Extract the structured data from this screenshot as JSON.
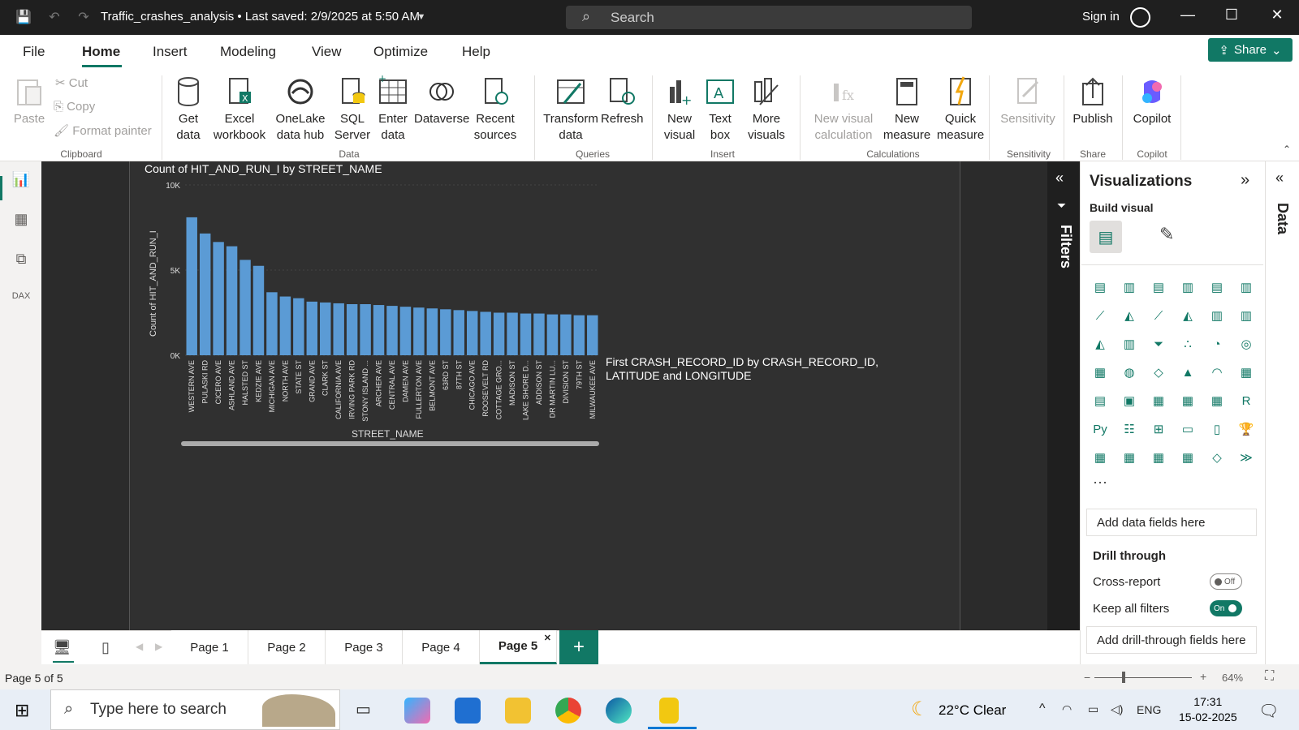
{
  "titlebar": {
    "file_title": "Traffic_crashes_analysis • Last saved: 2/9/2025 at 5:50 AM",
    "search_placeholder": "Search",
    "signin": "Sign in"
  },
  "menu": {
    "items": [
      "File",
      "Home",
      "Insert",
      "Modeling",
      "View",
      "Optimize",
      "Help"
    ],
    "share": "Share"
  },
  "ribbon": {
    "clipboard": {
      "paste": "Paste",
      "cut": "Cut",
      "copy": "Copy",
      "format_painter": "Format painter",
      "group": "Clipboard"
    },
    "data": {
      "get_data": "Get data",
      "excel": "Excel workbook",
      "onelake": "OneLake data hub",
      "sql": "SQL Server",
      "enter_data": "Enter data",
      "dataverse": "Dataverse",
      "recent": "Recent sources",
      "group": "Data"
    },
    "queries": {
      "transform": "Transform data",
      "refresh": "Refresh",
      "group": "Queries"
    },
    "insert": {
      "new_visual": "New visual",
      "text_box": "Text box",
      "more_visuals": "More visuals",
      "group": "Insert"
    },
    "calculations": {
      "new_visual_calc": "New visual calculation",
      "new_measure": "New measure",
      "quick_measure": "Quick measure",
      "group": "Calculations"
    },
    "sensitivity": {
      "label": "Sensitivity",
      "group": "Sensitivity"
    },
    "share": {
      "publish": "Publish",
      "group": "Share"
    },
    "copilot": {
      "label": "Copilot",
      "group": "Copilot"
    }
  },
  "chart_data": {
    "type": "bar",
    "title": "Count of HIT_AND_RUN_I by STREET_NAME",
    "xlabel": "STREET_NAME",
    "ylabel": "Count of HIT_AND_RUN_I",
    "ylim": [
      0,
      10000
    ],
    "yticks": [
      "10K",
      "5K",
      "0K"
    ],
    "categories": [
      "WESTERN AVE",
      "PULASKI RD",
      "CICERO AVE",
      "ASHLAND AVE",
      "HALSTED ST",
      "KEDZIE AVE",
      "MICHIGAN AVE",
      "NORTH AVE",
      "STATE ST",
      "GRAND AVE",
      "CLARK ST",
      "CALIFORNIA AVE",
      "IRVING PARK RD",
      "STONY ISLAND ...",
      "ARCHER AVE",
      "CENTRAL AVE",
      "DAMEN AVE",
      "FULLERTON AVE",
      "BELMONT AVE",
      "63RD ST",
      "87TH ST",
      "CHICAGO AVE",
      "ROOSEVELT RD",
      "COTTAGE GRO...",
      "MADISON ST",
      "LAKE SHORE D...",
      "ADDISON ST",
      "DR MARTIN LU...",
      "DIVISION ST",
      "79TH ST",
      "MILWAUKEE AVE"
    ],
    "values": [
      8100,
      7150,
      6650,
      6400,
      5600,
      5250,
      3700,
      3450,
      3350,
      3150,
      3100,
      3050,
      3000,
      3000,
      2950,
      2900,
      2850,
      2800,
      2750,
      2700,
      2650,
      2600,
      2550,
      2500,
      2500,
      2450,
      2450,
      2400,
      2400,
      2350,
      2350
    ]
  },
  "map_visual": {
    "title": "First CRASH_RECORD_ID by CRASH_RECORD_ID, LATITUDE and LONGITUDE"
  },
  "panes": {
    "filters": "Filters",
    "visualizations": "Visualizations",
    "build_visual": "Build visual",
    "data": "Data",
    "add_data_fields": "Add data fields here",
    "drill_through": "Drill through",
    "cross_report": "Cross-report",
    "cross_report_state": "Off",
    "keep_filters": "Keep all filters",
    "keep_filters_state": "On",
    "add_drill_fields": "Add drill-through fields here"
  },
  "pages": [
    "Page 1",
    "Page 2",
    "Page 3",
    "Page 4",
    "Page 5"
  ],
  "status": {
    "page_indicator": "Page 5 of 5",
    "zoom": "64%"
  },
  "taskbar": {
    "search_placeholder": "Type here to search",
    "weather": "22°C  Clear",
    "lang": "ENG",
    "time": "17:31",
    "date": "15-02-2025"
  }
}
